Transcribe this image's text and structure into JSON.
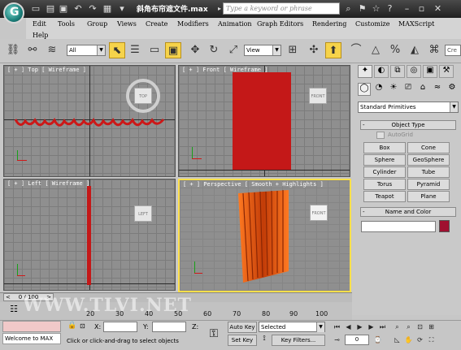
{
  "window": {
    "title": "斜角布帘遮文件.max",
    "search_placeholder": "Type a keyword or phrase"
  },
  "menu": [
    "Edit",
    "Tools",
    "Group",
    "Views",
    "Create",
    "Modifiers",
    "Animation",
    "Graph Editors",
    "Rendering",
    "Customize",
    "MAXScript",
    "Help"
  ],
  "toolbar": {
    "selection_filter": "All",
    "reference_coord": "View",
    "search_tail": "Cre"
  },
  "viewports": {
    "top": {
      "label": "[ + ] Top [ Wireframe ]",
      "cube": "TOP"
    },
    "front": {
      "label": "[ + ] Front [ Wireframe ]",
      "cube": "FRONT"
    },
    "left": {
      "label": "[ + ] Left [ Wireframe ]",
      "cube": "LEFT"
    },
    "perspective": {
      "label": "[ + ] Perspective [ Smooth + Highlights ]",
      "cube": "FRONT"
    }
  },
  "command_panel": {
    "category": "Standard Primitives",
    "object_type_title": "Object Type",
    "autogrid": "AutoGrid",
    "buttons": [
      "Box",
      "Cone",
      "Sphere",
      "GeoSphere",
      "Cylinder",
      "Tube",
      "Torus",
      "Pyramid",
      "Teapot",
      "Plane"
    ],
    "name_color_title": "Name and Color",
    "object_color": "#a01030"
  },
  "timeline": {
    "frame": "0 / 100",
    "ticks": [
      "20",
      "30",
      "40",
      "50",
      "60",
      "70",
      "80",
      "90",
      "100"
    ]
  },
  "status": {
    "welcome": "Welcome to MAX",
    "prompt": "Click or click-and-drag to select objects",
    "x_label": "X:",
    "y_label": "Y:",
    "z_label": "Z:",
    "auto_key": "Auto Key",
    "set_key": "Set Key",
    "selected": "Selected",
    "key_filters": "Key Filters...",
    "current_frame": "0"
  },
  "watermark": "WWW.TLVI.NET",
  "colors": {
    "curtain": "#c41818",
    "active_border": "#ffe04a",
    "selected_tool": "#f6d34a"
  }
}
